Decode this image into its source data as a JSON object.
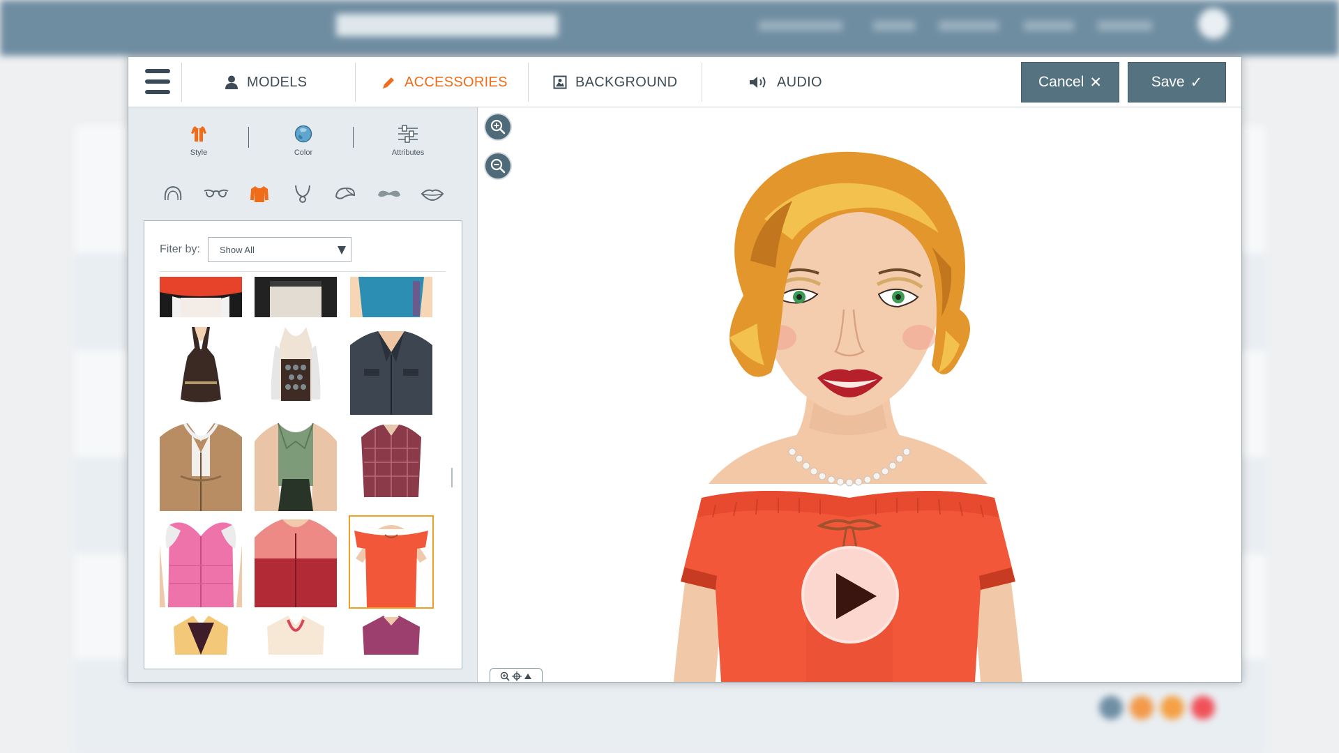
{
  "toolbar": {
    "tabs": [
      {
        "label": "MODELS",
        "icon": "user-icon",
        "active": false
      },
      {
        "label": "ACCESSORIES",
        "icon": "pencil-icon",
        "active": true
      },
      {
        "label": "BACKGROUND",
        "icon": "image-icon",
        "active": false
      },
      {
        "label": "AUDIO",
        "icon": "speaker-icon",
        "active": false
      }
    ],
    "cancel_label": "Cancel",
    "cancel_icon": "✕",
    "save_label": "Save",
    "save_icon": "✓"
  },
  "panel": {
    "mode_tabs": [
      {
        "label": "Style",
        "icon": "shirt-icon"
      },
      {
        "label": "Color",
        "icon": "globe-icon"
      },
      {
        "label": "Attributes",
        "icon": "sliders-icon"
      }
    ],
    "categories": [
      "hair-icon",
      "glasses-icon",
      "top-icon",
      "necklace-icon",
      "hat-icon",
      "mustache-icon",
      "lips-icon"
    ],
    "active_category": "top-icon",
    "filter_label": "Fiter by:",
    "filter_value": "Show All"
  },
  "colors": {
    "accent": "#ef6c1a",
    "header_button": "#557280",
    "selected_outline": "#f0a020",
    "panel_bg": "#e5ebee"
  },
  "canvas": {
    "zoom_in_icon": "zoom-in-icon",
    "zoom_out_icon": "zoom-out-icon",
    "play_icon": "play-icon"
  }
}
